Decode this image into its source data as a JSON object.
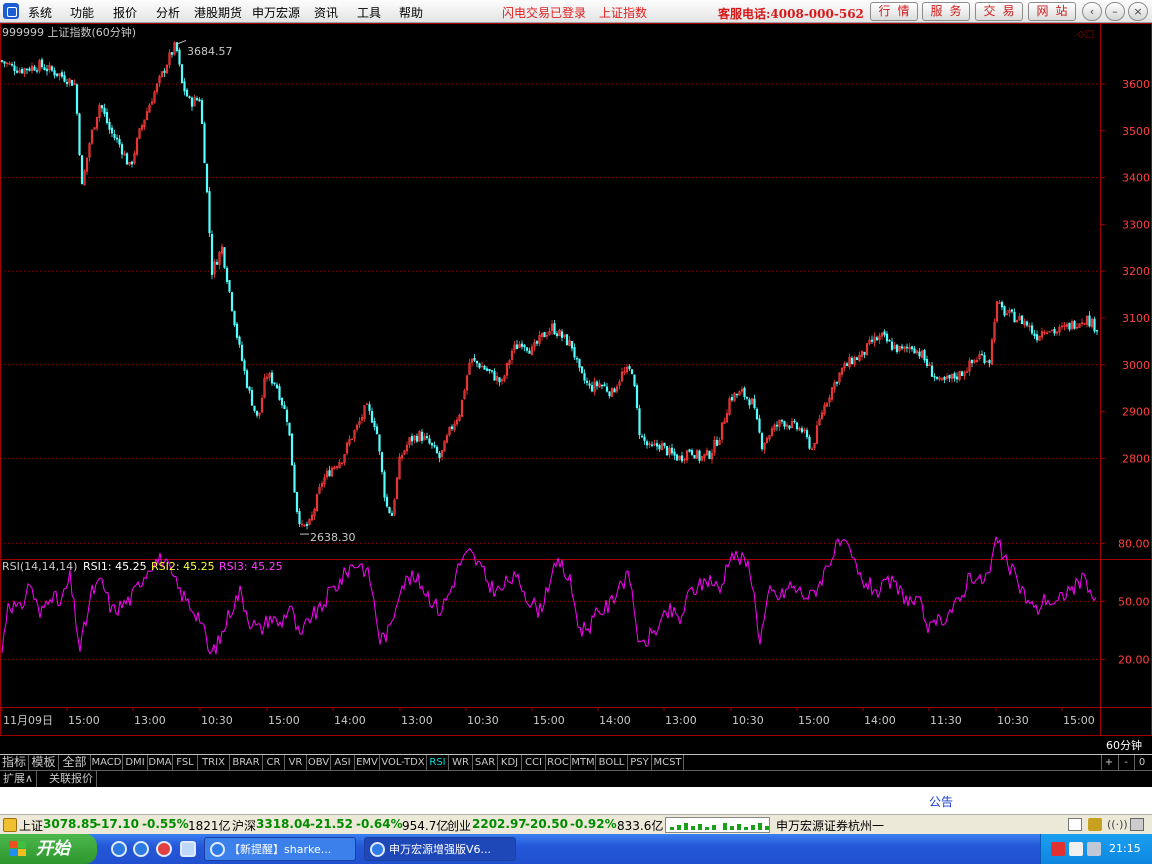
{
  "menu": {
    "items": [
      "系统",
      "功能",
      "报价",
      "分析",
      "港股期货",
      "申万宏源",
      "资讯",
      "工具",
      "帮助"
    ],
    "status_login": "闪电交易已登录",
    "status_index": "上证指数",
    "hotline": "客服电话:4008-000-562",
    "buttons": [
      "行情",
      "服务",
      "交易",
      "网站"
    ]
  },
  "chart": {
    "code_title": "999999 上证指数(60分钟)",
    "high_label": "3684.57",
    "low_label": "2638.30",
    "price_axis_labels": [
      "3600",
      "3500",
      "3400",
      "3300",
      "3200",
      "3100",
      "3000",
      "2900",
      "2800"
    ],
    "rsi_header": {
      "name": "RSI(14,14,14)",
      "rsi1": "RSI1: 45.25",
      "rsi2": "RSI2: 45.25",
      "rsi3": "RSI3: 45.25"
    },
    "rsi_axis_labels": [
      "80.00",
      "50.00",
      "20.00"
    ],
    "time_labels": [
      "11月09日",
      "15:00",
      "13:00",
      "10:30",
      "15:00",
      "14:00",
      "13:00",
      "10:30",
      "15:00",
      "14:00",
      "13:00",
      "10:30",
      "15:00",
      "14:00",
      "11:30",
      "10:30",
      "15:00"
    ],
    "period_label": "60分钟",
    "colors": {
      "up": "#ff3c3c",
      "down": "#54ffff",
      "rsi": "#ff00ff",
      "grid": "#a00000",
      "axis_text": "#ff4040"
    }
  },
  "chart_data": {
    "type": "candlestick",
    "title": "999999 上证指数(60分钟)",
    "high_marker": 3684.57,
    "low_marker": 2638.3,
    "ylim": [
      2600,
      3720
    ],
    "close_path": [
      [
        0,
        3650
      ],
      [
        20,
        3630
      ],
      [
        40,
        3640
      ],
      [
        60,
        3620
      ],
      [
        75,
        3600
      ],
      [
        82,
        3380
      ],
      [
        90,
        3480
      ],
      [
        100,
        3560
      ],
      [
        110,
        3500
      ],
      [
        120,
        3470
      ],
      [
        130,
        3420
      ],
      [
        140,
        3500
      ],
      [
        150,
        3560
      ],
      [
        160,
        3610
      ],
      [
        170,
        3660
      ],
      [
        176,
        3684
      ],
      [
        182,
        3600
      ],
      [
        190,
        3560
      ],
      [
        200,
        3570
      ],
      [
        206,
        3400
      ],
      [
        212,
        3200
      ],
      [
        222,
        3250
      ],
      [
        230,
        3150
      ],
      [
        238,
        3050
      ],
      [
        248,
        2950
      ],
      [
        258,
        2880
      ],
      [
        266,
        2980
      ],
      [
        276,
        2960
      ],
      [
        288,
        2880
      ],
      [
        296,
        2700
      ],
      [
        302,
        2650
      ],
      [
        310,
        2660
      ],
      [
        322,
        2750
      ],
      [
        332,
        2780
      ],
      [
        342,
        2800
      ],
      [
        350,
        2840
      ],
      [
        358,
        2870
      ],
      [
        366,
        2910
      ],
      [
        376,
        2870
      ],
      [
        386,
        2700
      ],
      [
        392,
        2680
      ],
      [
        400,
        2800
      ],
      [
        410,
        2840
      ],
      [
        420,
        2850
      ],
      [
        430,
        2830
      ],
      [
        440,
        2800
      ],
      [
        450,
        2860
      ],
      [
        460,
        2900
      ],
      [
        470,
        3010
      ],
      [
        480,
        3000
      ],
      [
        492,
        2980
      ],
      [
        502,
        2960
      ],
      [
        512,
        3030
      ],
      [
        522,
        3050
      ],
      [
        532,
        3030
      ],
      [
        542,
        3060
      ],
      [
        552,
        3080
      ],
      [
        562,
        3060
      ],
      [
        572,
        3040
      ],
      [
        580,
        2980
      ],
      [
        590,
        2950
      ],
      [
        600,
        2960
      ],
      [
        612,
        2940
      ],
      [
        622,
        2980
      ],
      [
        632,
        2990
      ],
      [
        640,
        2850
      ],
      [
        650,
        2820
      ],
      [
        660,
        2830
      ],
      [
        670,
        2810
      ],
      [
        680,
        2800
      ],
      [
        690,
        2820
      ],
      [
        700,
        2800
      ],
      [
        710,
        2810
      ],
      [
        720,
        2850
      ],
      [
        730,
        2930
      ],
      [
        742,
        2940
      ],
      [
        752,
        2920
      ],
      [
        762,
        2830
      ],
      [
        772,
        2860
      ],
      [
        782,
        2880
      ],
      [
        792,
        2870
      ],
      [
        802,
        2860
      ],
      [
        812,
        2820
      ],
      [
        822,
        2900
      ],
      [
        832,
        2950
      ],
      [
        842,
        2990
      ],
      [
        852,
        3010
      ],
      [
        862,
        3020
      ],
      [
        872,
        3050
      ],
      [
        882,
        3060
      ],
      [
        892,
        3040
      ],
      [
        902,
        3030
      ],
      [
        912,
        3040
      ],
      [
        922,
        3020
      ],
      [
        930,
        2990
      ],
      [
        940,
        2960
      ],
      [
        950,
        2970
      ],
      [
        960,
        2980
      ],
      [
        970,
        3000
      ],
      [
        980,
        3020
      ],
      [
        990,
        3010
      ],
      [
        996,
        3130
      ],
      [
        1006,
        3110
      ],
      [
        1016,
        3100
      ],
      [
        1026,
        3090
      ],
      [
        1036,
        3060
      ],
      [
        1046,
        3080
      ],
      [
        1056,
        3070
      ],
      [
        1066,
        3080
      ],
      [
        1076,
        3090
      ],
      [
        1086,
        3100
      ],
      [
        1096,
        3080
      ]
    ],
    "rsi_path": [
      [
        0,
        15
      ],
      [
        8,
        50
      ],
      [
        20,
        45
      ],
      [
        30,
        60
      ],
      [
        40,
        42
      ],
      [
        50,
        55
      ],
      [
        60,
        48
      ],
      [
        70,
        62
      ],
      [
        80,
        25
      ],
      [
        92,
        55
      ],
      [
        102,
        60
      ],
      [
        112,
        45
      ],
      [
        122,
        48
      ],
      [
        132,
        52
      ],
      [
        142,
        62
      ],
      [
        152,
        70
      ],
      [
        162,
        72
      ],
      [
        170,
        65
      ],
      [
        180,
        55
      ],
      [
        190,
        48
      ],
      [
        200,
        42
      ],
      [
        210,
        22
      ],
      [
        220,
        30
      ],
      [
        230,
        45
      ],
      [
        240,
        55
      ],
      [
        250,
        40
      ],
      [
        260,
        35
      ],
      [
        270,
        42
      ],
      [
        280,
        38
      ],
      [
        290,
        48
      ],
      [
        300,
        30
      ],
      [
        310,
        42
      ],
      [
        320,
        45
      ],
      [
        330,
        55
      ],
      [
        340,
        60
      ],
      [
        350,
        68
      ],
      [
        360,
        70
      ],
      [
        370,
        62
      ],
      [
        380,
        30
      ],
      [
        390,
        35
      ],
      [
        400,
        58
      ],
      [
        410,
        62
      ],
      [
        420,
        60
      ],
      [
        430,
        52
      ],
      [
        440,
        45
      ],
      [
        450,
        55
      ],
      [
        460,
        70
      ],
      [
        470,
        75
      ],
      [
        480,
        68
      ],
      [
        490,
        58
      ],
      [
        500,
        55
      ],
      [
        510,
        62
      ],
      [
        520,
        60
      ],
      [
        530,
        50
      ],
      [
        540,
        45
      ],
      [
        550,
        62
      ],
      [
        560,
        70
      ],
      [
        570,
        60
      ],
      [
        580,
        35
      ],
      [
        590,
        38
      ],
      [
        600,
        45
      ],
      [
        610,
        48
      ],
      [
        620,
        60
      ],
      [
        630,
        62
      ],
      [
        640,
        25
      ],
      [
        650,
        32
      ],
      [
        660,
        38
      ],
      [
        670,
        45
      ],
      [
        680,
        40
      ],
      [
        690,
        55
      ],
      [
        700,
        58
      ],
      [
        710,
        62
      ],
      [
        720,
        55
      ],
      [
        730,
        75
      ],
      [
        740,
        72
      ],
      [
        750,
        68
      ],
      [
        760,
        30
      ],
      [
        770,
        55
      ],
      [
        780,
        52
      ],
      [
        790,
        58
      ],
      [
        800,
        55
      ],
      [
        810,
        52
      ],
      [
        820,
        60
      ],
      [
        830,
        72
      ],
      [
        840,
        80
      ],
      [
        850,
        75
      ],
      [
        860,
        62
      ],
      [
        870,
        58
      ],
      [
        880,
        55
      ],
      [
        890,
        60
      ],
      [
        900,
        55
      ],
      [
        910,
        50
      ],
      [
        920,
        48
      ],
      [
        930,
        35
      ],
      [
        940,
        40
      ],
      [
        950,
        45
      ],
      [
        960,
        50
      ],
      [
        970,
        65
      ],
      [
        980,
        60
      ],
      [
        990,
        65
      ],
      [
        996,
        82
      ],
      [
        1006,
        70
      ],
      [
        1016,
        62
      ],
      [
        1026,
        52
      ],
      [
        1036,
        45
      ],
      [
        1046,
        52
      ],
      [
        1056,
        48
      ],
      [
        1066,
        55
      ],
      [
        1076,
        58
      ],
      [
        1086,
        62
      ],
      [
        1096,
        48
      ]
    ],
    "rsi_ylim": [
      0,
      100
    ]
  },
  "tabs": {
    "indicator_tabs": [
      "指标",
      "模板",
      "全部",
      "MACD",
      "DMI",
      "DMA",
      "FSL",
      "TRIX",
      "BRAR",
      "CR",
      "VR",
      "OBV",
      "ASI",
      "EMV",
      "VOL-TDX",
      "RSI",
      "WR",
      "SAR",
      "KDJ",
      "CCI",
      "ROC",
      "MTM",
      "BOLL",
      "PSY",
      "MCST"
    ],
    "selected": "RSI",
    "ext_tabs": [
      "扩展∧",
      "关联报价"
    ],
    "corner": [
      "+",
      "-",
      "0"
    ]
  },
  "bulletin": {
    "title": "公告"
  },
  "status": {
    "sh_name": "上证",
    "sh_price": "3078.85",
    "sh_chg": "-17.10",
    "sh_pct": "-0.55%",
    "sh_amt": "1821亿",
    "hs_name": "沪深",
    "hs_price": "3318.04",
    "hs_chg": "-21.52",
    "hs_pct": "-0.64%",
    "hs_amt": "954.7亿",
    "cy_name": "创业",
    "cy_price": "2202.97",
    "cy_chg": "-20.50",
    "cy_pct": "-0.92%",
    "cy_amt": "833.6亿",
    "broker": "申万宏源证券杭州一"
  },
  "taskbar": {
    "start": "开始",
    "tasks": [
      "【新提醒】sharke...",
      "申万宏源增强版V6..."
    ],
    "clock": "21:15"
  }
}
